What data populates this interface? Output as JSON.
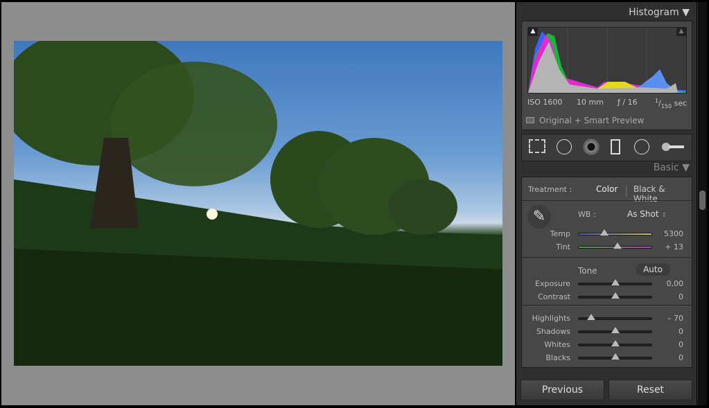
{
  "histogram": {
    "title": "Histogram",
    "iso": "ISO 1600",
    "focal": "10 mm",
    "aperture": "ƒ / 16",
    "shutter_num": "1",
    "shutter_den": "150",
    "shutter_unit": "sec",
    "preview_status": "Original + Smart Preview"
  },
  "tools": [
    "crop-overlay",
    "spot-removal",
    "red-eye-correction",
    "graduated-filter",
    "radial-filter",
    "adjustment-brush"
  ],
  "basic": {
    "title": "Basic",
    "treatment_label": "Treatment :",
    "treatment_color": "Color",
    "treatment_bw": "Black & White",
    "wb_label": "WB :",
    "wb_value": "As Shot",
    "tone_label": "Tone",
    "auto_label": "Auto",
    "sliders": [
      {
        "label": "Temp",
        "value": "5300",
        "pos": 0.35
      },
      {
        "label": "Tint",
        "value": "+ 13",
        "pos": 0.53
      },
      {
        "label": "Exposure",
        "value": "0,00",
        "pos": 0.5
      },
      {
        "label": "Contrast",
        "value": "0",
        "pos": 0.5
      },
      {
        "label": "Highlights",
        "value": "– 70",
        "pos": 0.17
      },
      {
        "label": "Shadows",
        "value": "0",
        "pos": 0.5
      },
      {
        "label": "Whites",
        "value": "0",
        "pos": 0.5
      },
      {
        "label": "Blacks",
        "value": "0",
        "pos": 0.5
      }
    ]
  },
  "buttons": {
    "previous": "Previous",
    "reset": "Reset"
  }
}
